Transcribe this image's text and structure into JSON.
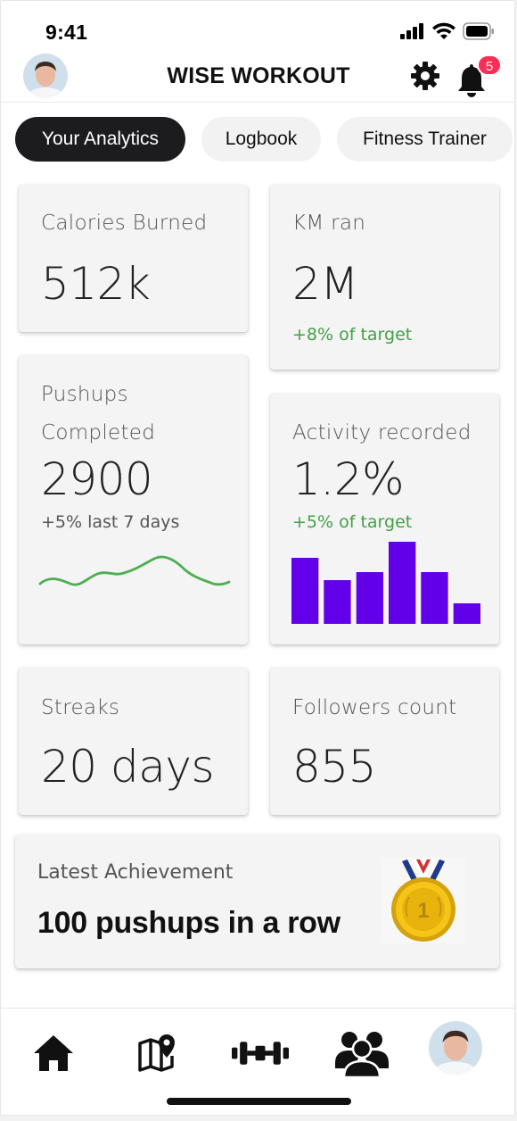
{
  "status_bar": {
    "time": "9:41"
  },
  "header": {
    "title": "WISE WORKOUT",
    "notification_count": "5"
  },
  "tabs": [
    {
      "label": "Your Analytics",
      "active": true
    },
    {
      "label": "Logbook",
      "active": false
    },
    {
      "label": "Fitness Trainer",
      "active": false
    }
  ],
  "cards": {
    "calories": {
      "label": "Calories Burned",
      "value": "512k"
    },
    "km": {
      "label": "KM ran",
      "value": "2M",
      "sub": "+8% of target"
    },
    "pushups": {
      "label_line1": "Pushups",
      "label_line2": "Completed",
      "value": "2900",
      "sub": "+5% last 7 days"
    },
    "activity": {
      "label": "Activity recorded",
      "value": "1.2%",
      "sub": "+5% of target",
      "bars": [
        0.8,
        0.53,
        0.63,
        1.0,
        0.63,
        0.25
      ]
    },
    "streaks": {
      "label": "Streaks",
      "value": "20 days"
    },
    "followers": {
      "label": "Followers count",
      "value": "855"
    },
    "achievement": {
      "label": "Latest Achievement",
      "text": "100 pushups in a row",
      "medal_number": "1"
    }
  },
  "colors": {
    "accent_green": "#43a047",
    "bar_purple": "#6200ea",
    "tab_active": "#1c1c1e",
    "badge_red": "#ff2d55"
  },
  "nav": {
    "icons": [
      "home-icon",
      "map-pin-icon",
      "dumbbell-icon",
      "group-icon",
      "profile-avatar"
    ]
  }
}
